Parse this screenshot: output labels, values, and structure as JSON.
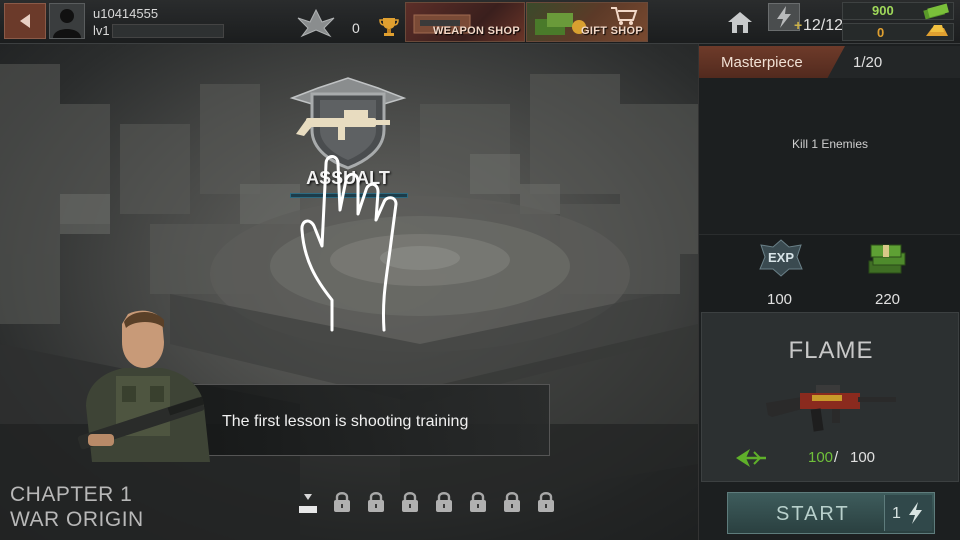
{
  "topbar": {
    "username": "u10414555",
    "level": "lv1",
    "trophy_count": "0",
    "weapon_shop_label": "WEAPON SHOP",
    "gift_shop_label": "GIFT SHOP",
    "energy": "12/12",
    "energy_plus": "+",
    "cash": "900",
    "gold": "0"
  },
  "mission": {
    "title": "Masterpiece",
    "progress": "1/20",
    "description": "Kill 1 Enemies",
    "rewards": {
      "exp_label": "EXP",
      "exp": "100",
      "money": "220"
    }
  },
  "weapon": {
    "name": "FLAME",
    "ammo_current": "100",
    "ammo_separator": "/",
    "ammo_max": "100"
  },
  "start": {
    "label": "START",
    "cost": "1"
  },
  "map": {
    "node_label": "ASSUALT",
    "dialog_text": "The first lesson is shooting training",
    "chapter_line1": "CHAPTER 1",
    "chapter_line2": "WAR ORIGIN",
    "stages": [
      "current",
      "locked",
      "locked",
      "locked",
      "locked",
      "locked",
      "locked",
      "locked"
    ]
  },
  "colors": {
    "accent_rust": "#6e3b2a",
    "cash_green": "#9fd85a",
    "gold_orange": "#e0a030",
    "ammo_green": "#6fc03a",
    "start_teal": "#3e5c5c"
  },
  "icons": {
    "back": "back-arrow-icon",
    "rank": "rank-wings-icon",
    "trophy": "trophy-icon",
    "home": "home-icon",
    "energy": "lightning-icon",
    "cash": "cash-icon",
    "gold": "gold-icon",
    "lock": "lock-icon",
    "hand": "tap-hand-icon"
  }
}
